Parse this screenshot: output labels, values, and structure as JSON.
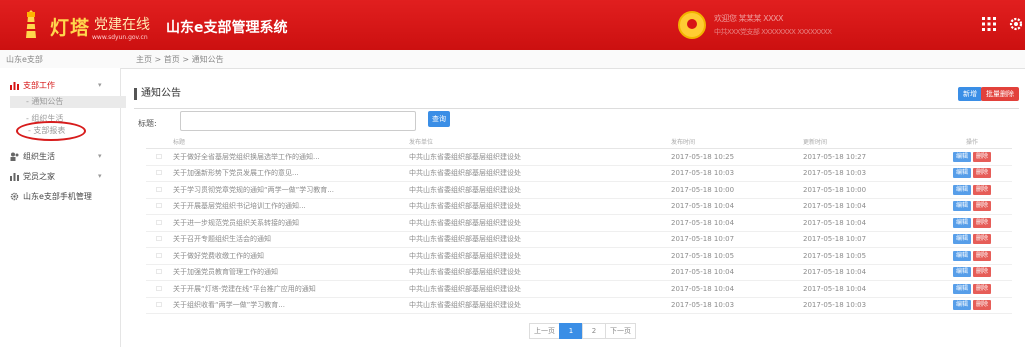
{
  "header": {
    "brand": "灯塔",
    "brand_sub": "党建在线",
    "brand_url": "www.sdyun.gov.cn",
    "system_title": "山东e支部管理系统",
    "user_line1": "欢迎您 某某某 XXXX",
    "user_line2": "中共XXX党支部 XXXXXXXX XXXXXXXX"
  },
  "breadcrumb": {
    "side_label": "山东e支部",
    "path": "主页 > 首页 > 通知公告"
  },
  "sidebar": {
    "items": [
      {
        "label": "支部工作",
        "arrow": "▾"
      },
      {
        "label": "组织生活",
        "arrow": "▾"
      },
      {
        "label": "党员之家",
        "arrow": "▾"
      },
      {
        "label": "山东e支部手机管理",
        "arrow": ""
      }
    ],
    "sub_items": [
      "- 通知公告",
      "- 组织生活",
      "- 支部报表"
    ]
  },
  "panel": {
    "title": "通知公告",
    "add_label": "新增",
    "batch_delete_label": "批量删除",
    "filter_label": "标题:",
    "filter_placeholder": "",
    "search_label": "查询"
  },
  "table": {
    "headers": [
      "",
      "标题",
      "发布单位",
      "发布时间",
      "更新时间",
      "操作"
    ],
    "edit_label": "编辑",
    "delete_label": "删除",
    "rows": [
      {
        "title": "关于做好全省基层党组织换届选举工作的通知...",
        "unit": "中共山东省委组织部基层组织建设处",
        "published": "2017-05-18 10:25",
        "updated": "2017-05-18 10:27"
      },
      {
        "title": "关于加强新形势下党员发展工作的意见...",
        "unit": "中共山东省委组织部基层组织建设处",
        "published": "2017-05-18 10:03",
        "updated": "2017-05-18 10:03"
      },
      {
        "title": "关于学习贯彻党章党规的通知“两学一做”学习教育...",
        "unit": "中共山东省委组织部基层组织建设处",
        "published": "2017-05-18 10:00",
        "updated": "2017-05-18 10:00"
      },
      {
        "title": "关于开展基层党组织书记培训工作的通知...",
        "unit": "中共山东省委组织部基层组织建设处",
        "published": "2017-05-18 10:04",
        "updated": "2017-05-18 10:04"
      },
      {
        "title": "关于进一步规范党员组织关系转接的通知",
        "unit": "中共山东省委组织部基层组织建设处",
        "published": "2017-05-18 10:04",
        "updated": "2017-05-18 10:04"
      },
      {
        "title": "关于召开专题组织生活会的通知",
        "unit": "中共山东省委组织部基层组织建设处",
        "published": "2017-05-18 10:07",
        "updated": "2017-05-18 10:07"
      },
      {
        "title": "关于做好党费收缴工作的通知",
        "unit": "中共山东省委组织部基层组织建设处",
        "published": "2017-05-18 10:05",
        "updated": "2017-05-18 10:05"
      },
      {
        "title": "关于加强党员教育管理工作的通知",
        "unit": "中共山东省委组织部基层组织建设处",
        "published": "2017-05-18 10:04",
        "updated": "2017-05-18 10:04"
      },
      {
        "title": "关于开展“灯塔-党建在线”平台推广应用的通知",
        "unit": "中共山东省委组织部基层组织建设处",
        "published": "2017-05-18 10:04",
        "updated": "2017-05-18 10:04"
      },
      {
        "title": "关于组织收看“两学一做”学习教育...",
        "unit": "中共山东省委组织部基层组织建设处",
        "published": "2017-05-18 10:03",
        "updated": "2017-05-18 10:03"
      }
    ]
  },
  "pagination": {
    "prev": "上一页",
    "pages": [
      "1",
      "2"
    ],
    "next": "下一页"
  },
  "colors": {
    "header_red": "#d61414",
    "accent_blue": "#3a8ee6",
    "danger_red": "#e2413b",
    "annotation_red": "#d71c1c"
  }
}
